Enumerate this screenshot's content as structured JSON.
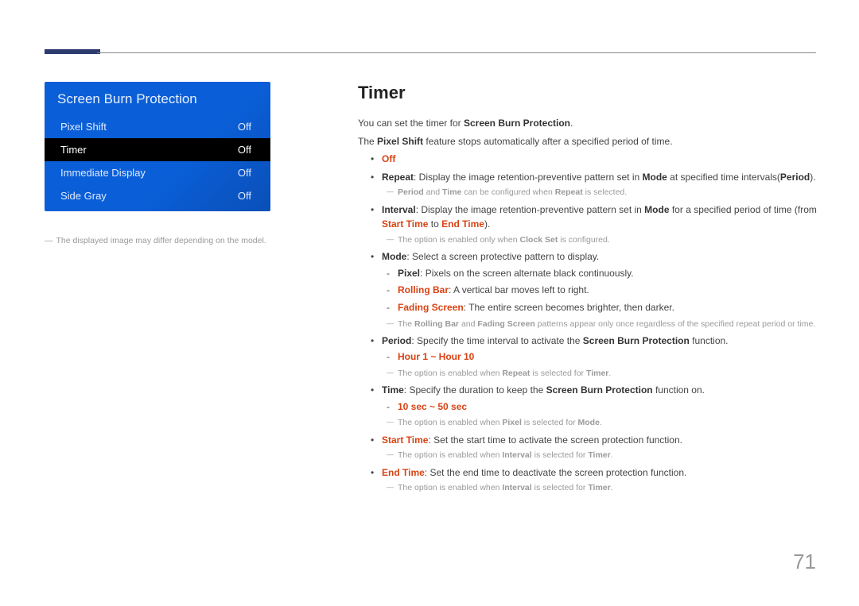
{
  "page_number": "71",
  "menu": {
    "title": "Screen Burn Protection",
    "items": [
      {
        "label": "Pixel Shift",
        "value": "Off"
      },
      {
        "label": "Timer",
        "value": "Off"
      },
      {
        "label": "Immediate Display",
        "value": "Off"
      },
      {
        "label": "Side Gray",
        "value": "Off"
      }
    ],
    "caption": "The displayed image may differ depending on the model."
  },
  "heading": "Timer",
  "intro1_a": "You can set the timer for ",
  "intro1_b": "Screen Burn Protection",
  "intro1_c": ".",
  "intro2_a": "The ",
  "intro2_b": "Pixel Shift",
  "intro2_c": " feature stops automatically after a specified period of time.",
  "off": "Off",
  "repeat_a": "Repeat",
  "repeat_b": ": Display the image retention-preventive pattern set in ",
  "repeat_c": "Mode",
  "repeat_d": " at specified time intervals(",
  "repeat_e": "Period",
  "repeat_f": ").",
  "repeat_note_a": "Period",
  "repeat_note_b": " and ",
  "repeat_note_c": "Time",
  "repeat_note_d": " can be configured when ",
  "repeat_note_e": "Repeat",
  "repeat_note_f": " is selected.",
  "interval_a": "Interval",
  "interval_b": ": Display the image retention-preventive pattern set in ",
  "interval_c": "Mode",
  "interval_d": " for a specified period of time (from ",
  "interval_e": "Start Time",
  "interval_f": " to ",
  "interval_g": "End Time",
  "interval_h": ").",
  "interval_note_a": "The option is enabled only when ",
  "interval_note_b": "Clock Set",
  "interval_note_c": " is configured.",
  "mode_a": "Mode",
  "mode_b": ": Select a screen protective pattern to display.",
  "pixel_a": "Pixel",
  "pixel_b": ": Pixels on the screen alternate black continuously.",
  "rolling_a": "Rolling Bar",
  "rolling_b": ": A vertical bar moves left to right.",
  "fading_a": "Fading Screen",
  "fading_b": ": The entire screen becomes brighter, then darker.",
  "mode_note_a": "The ",
  "mode_note_b": "Rolling Bar",
  "mode_note_c": " and ",
  "mode_note_d": "Fading Screen",
  "mode_note_e": " patterns appear only once regardless of the specified repeat period or time.",
  "period_a": "Period",
  "period_b": ": Specify the time interval to activate the ",
  "period_c": "Screen Burn Protection",
  "period_d": " function.",
  "period_val": "Hour 1 ~ Hour 10",
  "period_note_a": "The option is enabled when ",
  "period_note_b": "Repeat",
  "period_note_c": " is selected for ",
  "period_note_d": "Timer",
  "period_note_e": ".",
  "time_a": "Time",
  "time_b": ": Specify the duration to keep the ",
  "time_c": "Screen Burn Protection",
  "time_d": " function on.",
  "time_val": "10 sec  ~ 50 sec",
  "time_note_a": "The option is enabled when ",
  "time_note_b": "Pixel",
  "time_note_c": " is selected for ",
  "time_note_d": "Mode",
  "time_note_e": ".",
  "start_a": "Start Time",
  "start_b": ": Set the start time to activate the screen protection function.",
  "start_note_a": "The option is enabled when ",
  "start_note_b": "Interval",
  "start_note_c": " is selected for ",
  "start_note_d": "Timer",
  "start_note_e": ".",
  "end_a": "End Time",
  "end_b": ": Set the end time to deactivate the screen protection function.",
  "end_note_a": "The option is enabled when ",
  "end_note_b": "Interval",
  "end_note_c": " is selected for ",
  "end_note_d": "Timer",
  "end_note_e": "."
}
